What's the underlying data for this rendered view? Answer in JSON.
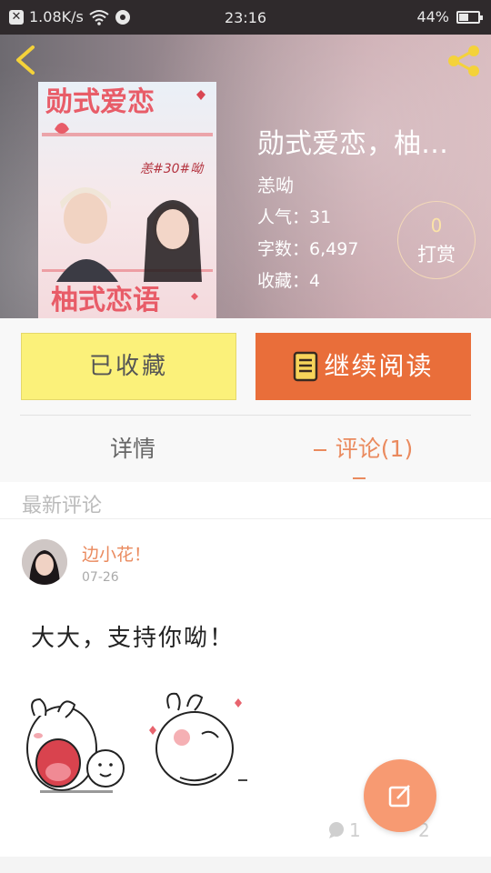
{
  "status_bar": {
    "speed": "1.08K/s",
    "time": "23:16",
    "battery": "44%",
    "battery_level": 0.44
  },
  "header": {
    "back_icon": "chevron-left-icon",
    "share_icon": "share-icon"
  },
  "book": {
    "title": "勋式爱恋，柚…",
    "author": "恙呦",
    "popularity_label": "人气：",
    "popularity": "31",
    "words_label": "字数：",
    "words": "6,497",
    "favorites_label": "收藏：",
    "favorites": "4",
    "reward_count": "0",
    "reward_label": "打赏",
    "cover_text": {
      "top": "勋式爱恋",
      "bottom": "柚式恋语",
      "badge": "恙#30#呦"
    }
  },
  "actions": {
    "collected_label": "已收藏",
    "continue_label": "继续阅读"
  },
  "tabs": {
    "detail": "详情",
    "comments": "评论(1)"
  },
  "comments_section": {
    "header": "最新评论",
    "items": [
      {
        "user": "边小花！",
        "date": "07-26",
        "text": "大大，支持你呦！",
        "reply_count": "1",
        "like_count": "2"
      }
    ]
  },
  "colors": {
    "accent": "#ea8a5e",
    "continue_button": "#e96e3a",
    "collected_button": "#fbf17a",
    "fab": "#f79a72"
  }
}
